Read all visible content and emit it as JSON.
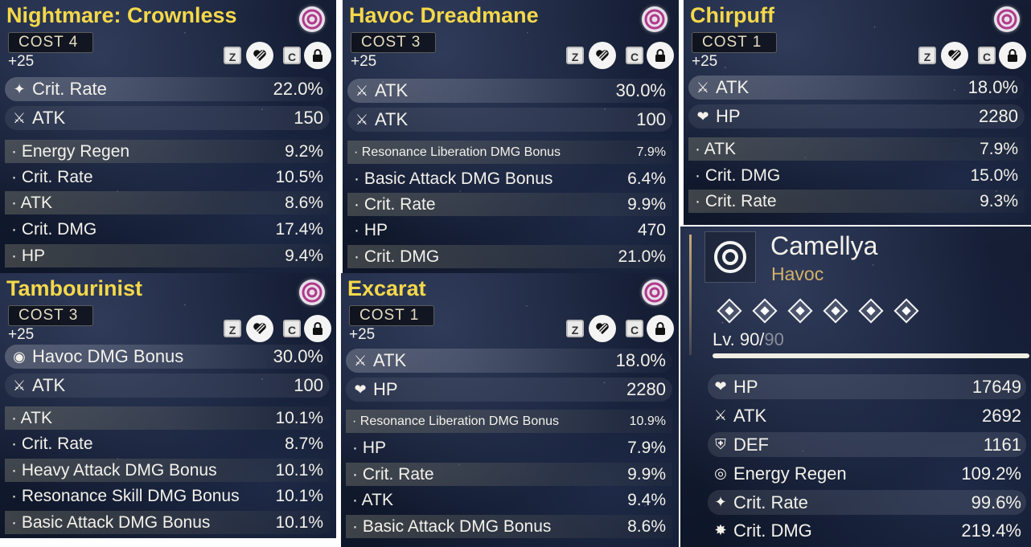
{
  "echoes": [
    {
      "name": "Nightmare: Crownless",
      "cost_label": "COST",
      "cost": "4",
      "level": "+25",
      "main_stats": [
        {
          "icon": "crit-rate-icon",
          "label": "Crit. Rate",
          "value": "22.0%"
        },
        {
          "icon": "atk-icon",
          "label": "ATK",
          "value": "150"
        }
      ],
      "sub_stats": [
        {
          "label": "· Energy Regen",
          "value": "9.2%"
        },
        {
          "label": "· Crit. Rate",
          "value": "10.5%"
        },
        {
          "label": "· ATK",
          "value": "8.6%"
        },
        {
          "label": "· Crit. DMG",
          "value": "17.4%"
        },
        {
          "label": "· HP",
          "value": "9.4%"
        }
      ]
    },
    {
      "name": "Havoc Dreadmane",
      "cost_label": "COST",
      "cost": "3",
      "level": "+25",
      "main_stats": [
        {
          "icon": "atk-icon",
          "label": "ATK",
          "value": "30.0%"
        },
        {
          "icon": "atk-icon",
          "label": "ATK",
          "value": "100"
        }
      ],
      "sub_stats": [
        {
          "label": "· Resonance Liberation DMG Bonus",
          "value": "7.9%"
        },
        {
          "label": "· Basic Attack DMG Bonus",
          "value": "6.4%"
        },
        {
          "label": "· Crit. Rate",
          "value": "9.9%"
        },
        {
          "label": "· HP",
          "value": "470"
        },
        {
          "label": "· Crit. DMG",
          "value": "21.0%"
        }
      ]
    },
    {
      "name": "Chirpuff",
      "cost_label": "COST",
      "cost": "1",
      "level": "+25",
      "main_stats": [
        {
          "icon": "atk-icon",
          "label": "ATK",
          "value": "18.0%"
        },
        {
          "icon": "hp-icon",
          "label": "HP",
          "value": "2280"
        }
      ],
      "sub_stats": [
        {
          "label": "· ATK",
          "value": "7.9%"
        },
        {
          "label": "· Crit. DMG",
          "value": "15.0%"
        },
        {
          "label": "· Crit. Rate",
          "value": "9.3%"
        }
      ]
    },
    {
      "name": "Tambourinist",
      "cost_label": "COST",
      "cost": "3",
      "level": "+25",
      "main_stats": [
        {
          "icon": "havoc-dmg-icon",
          "label": "Havoc DMG Bonus",
          "value": "30.0%"
        },
        {
          "icon": "atk-icon",
          "label": "ATK",
          "value": "100"
        }
      ],
      "sub_stats": [
        {
          "label": "· ATK",
          "value": "10.1%"
        },
        {
          "label": "· Crit. Rate",
          "value": "8.7%"
        },
        {
          "label": "· Heavy Attack DMG Bonus",
          "value": "10.1%"
        },
        {
          "label": "· Resonance Skill DMG Bonus",
          "value": "10.1%"
        },
        {
          "label": "· Basic Attack DMG Bonus",
          "value": "10.1%"
        }
      ]
    },
    {
      "name": "Excarat",
      "cost_label": "COST",
      "cost": "1",
      "level": "+25",
      "main_stats": [
        {
          "icon": "atk-icon",
          "label": "ATK",
          "value": "18.0%"
        },
        {
          "icon": "hp-icon",
          "label": "HP",
          "value": "2280"
        }
      ],
      "sub_stats": [
        {
          "label": "· Resonance Liberation DMG Bonus",
          "value": "10.9%"
        },
        {
          "label": "· HP",
          "value": "7.9%"
        },
        {
          "label": "· Crit. Rate",
          "value": "9.9%"
        },
        {
          "label": "· ATK",
          "value": "9.4%"
        },
        {
          "label": "· Basic Attack DMG Bonus",
          "value": "8.6%"
        }
      ]
    }
  ],
  "buttons": {
    "z": "Z",
    "c": "C"
  },
  "character": {
    "name": "Camellya",
    "attribute": "Havoc",
    "level_label": "Lv. 90/",
    "level_max": "90",
    "stats": [
      {
        "icon": "hp-icon",
        "label": "HP",
        "value": "17649"
      },
      {
        "icon": "atk-icon",
        "label": "ATK",
        "value": "2692"
      },
      {
        "icon": "def-icon",
        "label": "DEF",
        "value": "1161"
      },
      {
        "icon": "energy-regen-icon",
        "label": "Energy Regen",
        "value": "109.2%"
      },
      {
        "icon": "crit-rate-icon",
        "label": "Crit. Rate",
        "value": "99.6%"
      },
      {
        "icon": "crit-dmg-icon",
        "label": "Crit. DMG",
        "value": "219.4%"
      }
    ]
  },
  "colors": {
    "echo_name": "#f5d84a",
    "attribute": "#d4b168",
    "sonata": "#b03a8a"
  }
}
